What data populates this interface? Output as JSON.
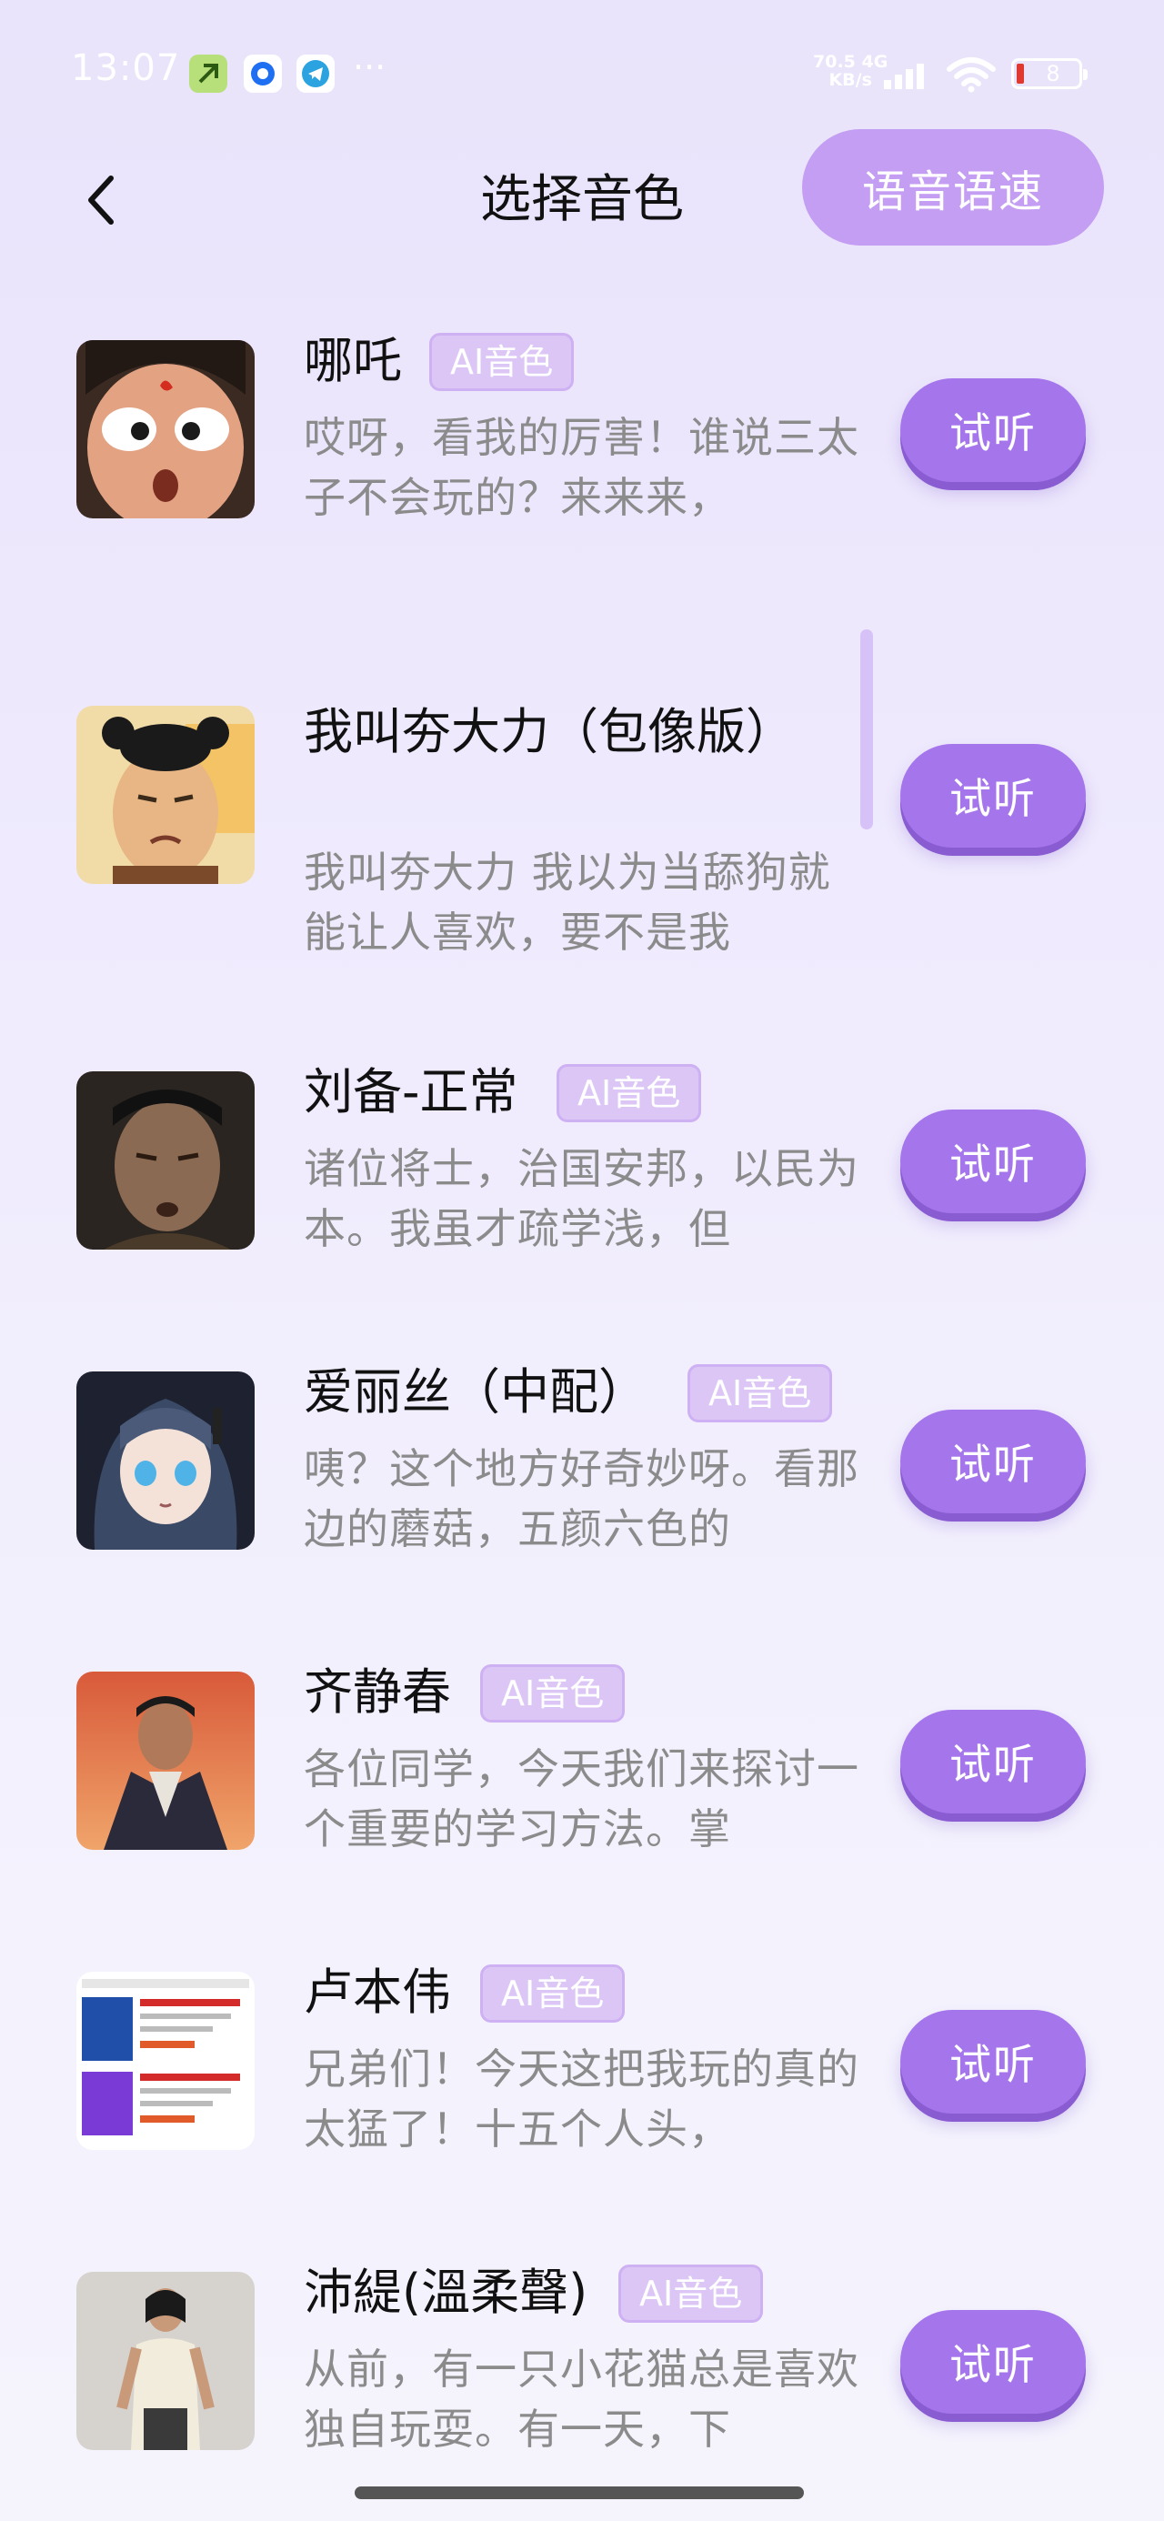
{
  "status_bar": {
    "time": "13:07",
    "speed_value": "70.5",
    "speed_unit": "KB/s",
    "network": "4G",
    "battery": "8",
    "more": "···"
  },
  "header": {
    "title": "选择音色",
    "speed_button": "语音语速"
  },
  "colors": {
    "accent": "#a575ec",
    "tag_bg": "#dcc6f6",
    "speed_button_bg": "#c49ef2"
  },
  "listen_label": "试听",
  "voices": [
    {
      "name": "哪吒",
      "tag": "AI音色",
      "desc": "哎呀，看我的厉害！谁说三太子不会玩的？来来来，"
    },
    {
      "name": "我叫夯大力（包像版）",
      "tag": "",
      "desc": "我叫夯大力 我以为当舔狗就能让人喜欢，要不是我"
    },
    {
      "name": "刘备-正常",
      "tag": "AI音色",
      "desc": "诸位将士，治国安邦，以民为本。我虽才疏学浅，但"
    },
    {
      "name": "爱丽丝（中配）",
      "tag": "AI音色",
      "desc": "咦？这个地方好奇妙呀。看那边的蘑菇，五颜六色的"
    },
    {
      "name": "齐静春",
      "tag": "AI音色",
      "desc": "各位同学，今天我们来探讨一个重要的学习方法。掌"
    },
    {
      "name": "卢本伟",
      "tag": "AI音色",
      "desc": "兄弟们！今天这把我玩的真的太猛了！十五个人头，"
    },
    {
      "name": "沛緹(溫柔聲)",
      "tag": "AI音色",
      "desc": "从前，有一只小花猫总是喜欢独自玩耍。有一天，下"
    }
  ]
}
